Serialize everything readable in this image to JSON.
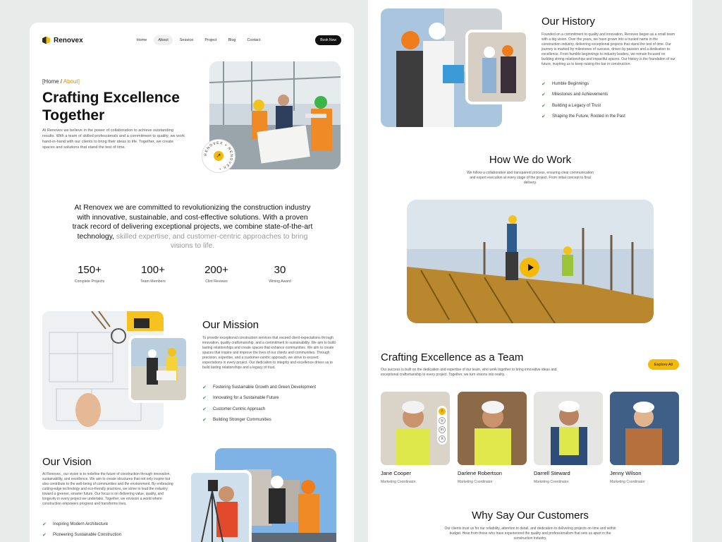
{
  "left": {
    "nav": {
      "brand": "Renovex",
      "menu": [
        "Home",
        "About",
        "Seavice",
        "Project",
        "Blog",
        "Contact"
      ],
      "active": "About",
      "cta": "Book Now"
    },
    "breadcrumb": {
      "home": "[Home",
      "sep": " / ",
      "current": "About]"
    },
    "hero": {
      "title": "Crafting Excellence Together",
      "text": "At Renovex we believe in the power of collaboration to achieve outstanding results. With a team of skilled professionals and a commitment to quality, we work hand-in-hand with our clients to bring their ideas to life. Together, we create spaces and solutions that stand the test of time.",
      "badge_text": "RENOVEX • RENOVEX •"
    },
    "statement": {
      "main": "At Renovex we are committed to revolutionizing the construction industry with innovative, sustainable, and cost-effective solutions. With a proven track record of delivering exceptional projects, we combine state-of-the-art technology,",
      "muted": " skilled expertise, and customer-centric approaches to bring visions to life."
    },
    "stats": [
      {
        "value": "150+",
        "label": "Complete Projects"
      },
      {
        "value": "100+",
        "label": "Team Members"
      },
      {
        "value": "200+",
        "label": "Clint Reviews"
      },
      {
        "value": "30",
        "label": "Wining Award"
      }
    ],
    "mission": {
      "title": "Our Mission",
      "text": "To provide exceptional construction services that exceed client expectations through innovation, quality craftsmanship, and a commitment to sustainability. We aim to build lasting relationships and create spaces that enhance communities. We aim to create spaces that inspire and improve the lives of our clients and communities. Through precision, expertise, and a customer-centric approach, we strive to exceed expectations in every project. Our dedication to integrity and excellence drives us to build lasting relationships and a legacy of trust.",
      "points": [
        "Fostering Sustainable Growth and Green Development",
        "Innovating for a Sustainable Future",
        "Customer-Centric Approach",
        "Building Stronger Communities"
      ]
    },
    "vision": {
      "title": "Our Vision",
      "text": "At Renovex , our vision is to redefine the future of construction through innovation, sustainability, and excellence. We aim to create structures that not only inspire but also contribute to the well-being of communities and the environment. By embracing cutting-edge technology and eco-friendly practices, we strive to lead the industry toward a greener, smarter future. Our focus is on delivering value, quality, and longevity in every project we undertake. Together, we envision a world where construction empowers progress and transforms lives.",
      "points": [
        "Inspiring Modern Architecture",
        "Pioneering Sustainable Construction"
      ]
    }
  },
  "right": {
    "history": {
      "title": "Our History",
      "text": "Founded on a commitment to quality and innovation, Renovex began as a small team with a big vision. Over the years, we have grown into a trusted name in the construction industry, delivering exceptional projects that stand the test of time. Our journey is marked by milestones of success, driven by passion and a dedication to excellence. From humble beginnings to industry leaders, we remain focused on building strong relationships and impactful spaces. Our history is the foundation of our future, inspiring us to keep raising the bar in construction.",
      "points": [
        "Humble Beginnings",
        "Milestones and Achievements",
        "Building a Legacy of Trust",
        "Shaping the Future, Rooted in the Past"
      ]
    },
    "how": {
      "title": "How We do Work",
      "text": "We follow a collaborative and transparent process, ensuring clear communication and expert execution at every stage of the project. From initial concept to final delivery."
    },
    "team": {
      "title": "Crafting Excellence as a Team",
      "text": "Our success is built on the dedication and expertise of our team, who work together to bring innovative ideas and exceptional craftsmanship to every project. Together, we turn visions into reality.",
      "cta": "Explore All",
      "members": [
        {
          "name": "Jane Cooper",
          "role": "Marketing Coordinator"
        },
        {
          "name": "Darlene Robertson",
          "role": "Marketing Coordinator"
        },
        {
          "name": "Darrell Steward",
          "role": "Marketing Coordinator"
        },
        {
          "name": "Jenny Wilson",
          "role": "Marketing Coordinator"
        }
      ],
      "socials": [
        "f",
        "◎",
        "in",
        "X"
      ]
    },
    "customers": {
      "title": "Why Say Our Customers",
      "text": "Our clients trust us for our reliability, attention to detail, and dedication to delivering projects on time and within budget. Hear from those who have experienced the quality and professionalism that sets us apart in the construction industry."
    }
  },
  "colors": {
    "accent": "#f5b90a",
    "check": "#3a9d4c",
    "background": "#e9ebea"
  }
}
